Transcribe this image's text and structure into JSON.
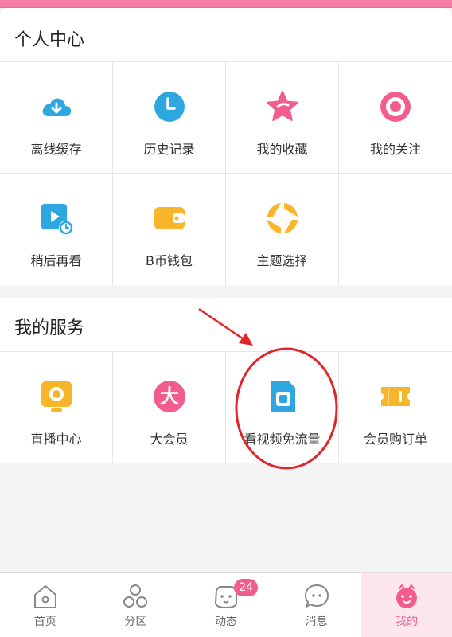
{
  "colors": {
    "brand_pink": "#f25d8e",
    "accent_blue": "#2ea7e0",
    "accent_yellow": "#f7b52c",
    "annotation_red": "#e1262b"
  },
  "personal_center": {
    "title": "个人中心",
    "items": [
      {
        "label": "离线缓存",
        "icon": "cloud-download-icon"
      },
      {
        "label": "历史记录",
        "icon": "clock-icon"
      },
      {
        "label": "我的收藏",
        "icon": "star-icon"
      },
      {
        "label": "我的关注",
        "icon": "target-icon"
      },
      {
        "label": "稍后再看",
        "icon": "watch-later-icon"
      },
      {
        "label": "B币钱包",
        "icon": "wallet-icon"
      },
      {
        "label": "主题选择",
        "icon": "theme-icon"
      }
    ]
  },
  "my_services": {
    "title": "我的服务",
    "items": [
      {
        "label": "直播中心",
        "icon": "live-tv-icon"
      },
      {
        "label": "大会员",
        "icon": "vip-icon"
      },
      {
        "label": "看视频免流量",
        "icon": "sim-card-icon"
      },
      {
        "label": "会员购订单",
        "icon": "ticket-icon"
      }
    ]
  },
  "tabbar": {
    "items": [
      {
        "label": "首页",
        "icon": "home-icon"
      },
      {
        "label": "分区",
        "icon": "category-icon"
      },
      {
        "label": "动态",
        "icon": "feed-icon",
        "badge": "24"
      },
      {
        "label": "消息",
        "icon": "message-icon"
      },
      {
        "label": "我的",
        "icon": "profile-icon",
        "active": true
      }
    ]
  }
}
